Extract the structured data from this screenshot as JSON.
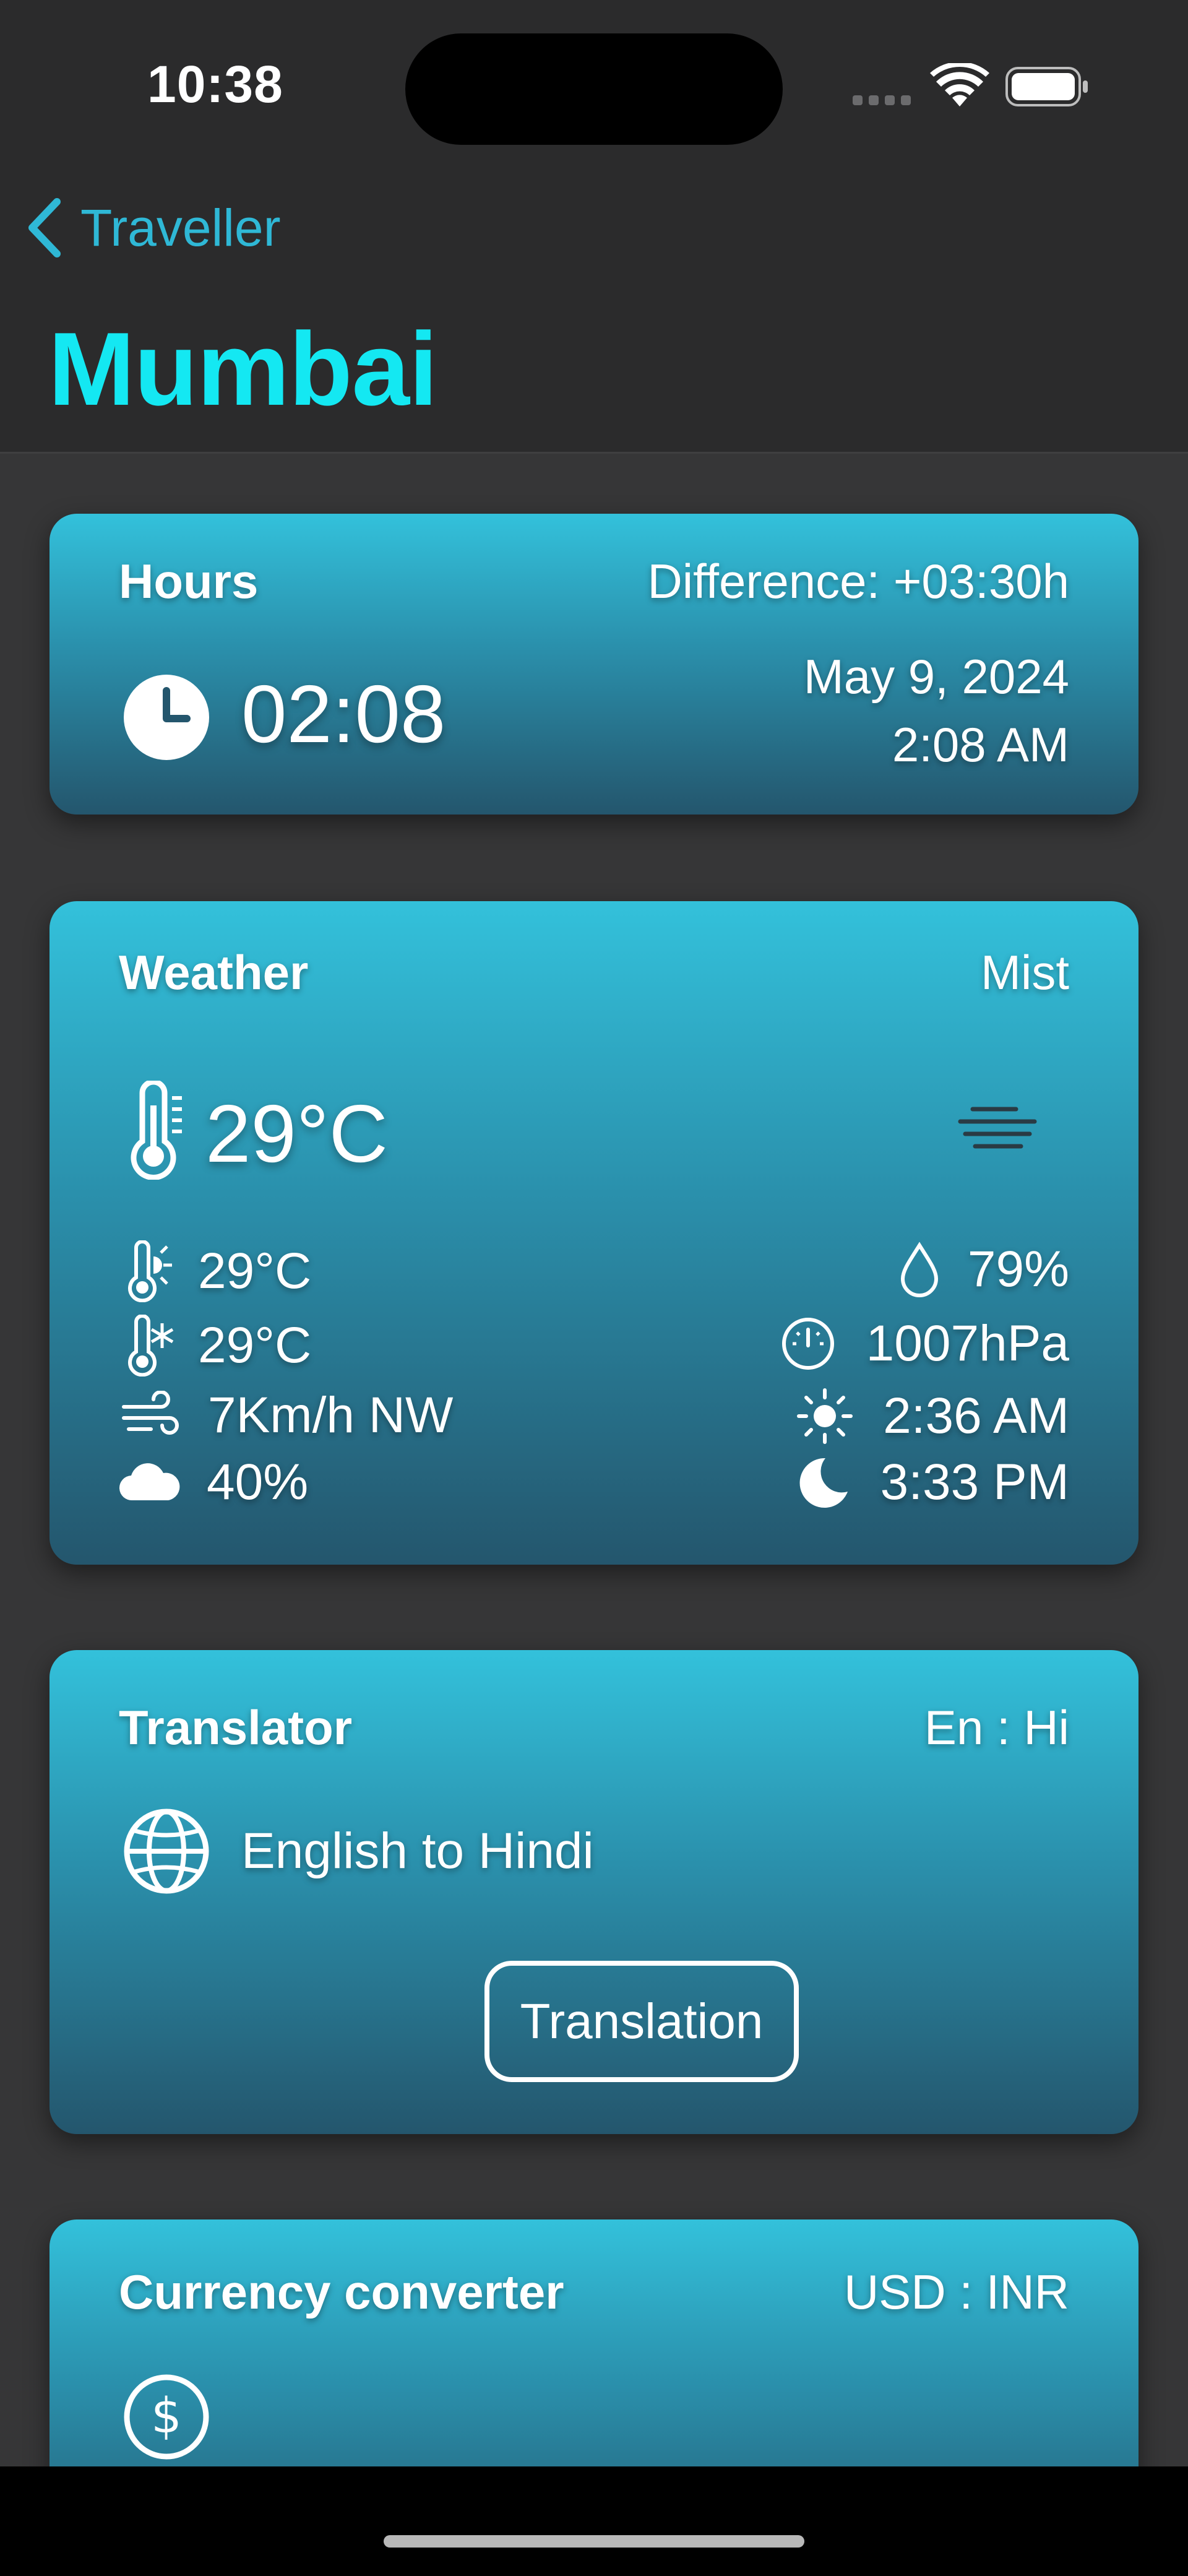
{
  "status_bar": {
    "time": "10:38"
  },
  "nav": {
    "back_label": "Traveller",
    "title": "Mumbai"
  },
  "hours_card": {
    "title": "Hours",
    "difference": "Difference: +03:30h",
    "time": "02:08",
    "date": "May 9, 2024",
    "time_ampm": "2:08 AM"
  },
  "weather_card": {
    "title": "Weather",
    "condition": "Mist",
    "temperature": "29°C",
    "feels_hot": "29°C",
    "feels_cold": "29°C",
    "wind": "7Km/h NW",
    "clouds": "40%",
    "humidity": "79%",
    "pressure": "1007hPa",
    "sunrise": "2:36 AM",
    "sunset": "3:33 PM"
  },
  "translator_card": {
    "title": "Translator",
    "pair": "En : Hi",
    "description": "English to Hindi",
    "button_label": "Translation"
  },
  "currency_card": {
    "title": "Currency converter",
    "pair": "USD : INR"
  },
  "colors": {
    "accent": "#14e8f2",
    "link": "#2fb8d6",
    "card_top": "#33c1db",
    "card_bottom": "#24566d",
    "background": "#363637"
  }
}
